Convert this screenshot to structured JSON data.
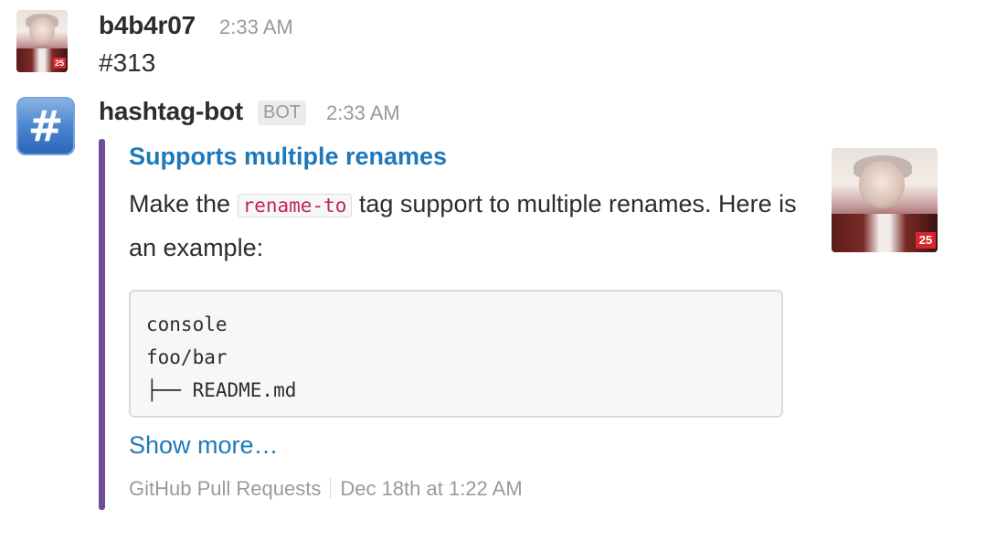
{
  "messages": [
    {
      "author": "b4b4r07",
      "time": "2:33 AM",
      "avatar_icon": "user-avatar-photo",
      "badge": "25",
      "text": "#313"
    },
    {
      "author": "hashtag-bot",
      "bot_tag": "BOT",
      "time": "2:33 AM",
      "avatar_icon": "hash-icon",
      "avatar_glyph": "#",
      "attachment": {
        "accent_color": "#6e4c9a",
        "title": "Supports multiple renames",
        "text_before": "Make the ",
        "inline_code": "rename-to",
        "text_after": " tag support to multiple renames. Here is an example:",
        "thumb_badge": "25",
        "code_lines": [
          "console",
          "foo/bar",
          "├── README.md"
        ],
        "show_more": "Show more…",
        "footer_source": "GitHub Pull Requests",
        "footer_date": "Dec 18th at 1:22 AM"
      }
    }
  ]
}
